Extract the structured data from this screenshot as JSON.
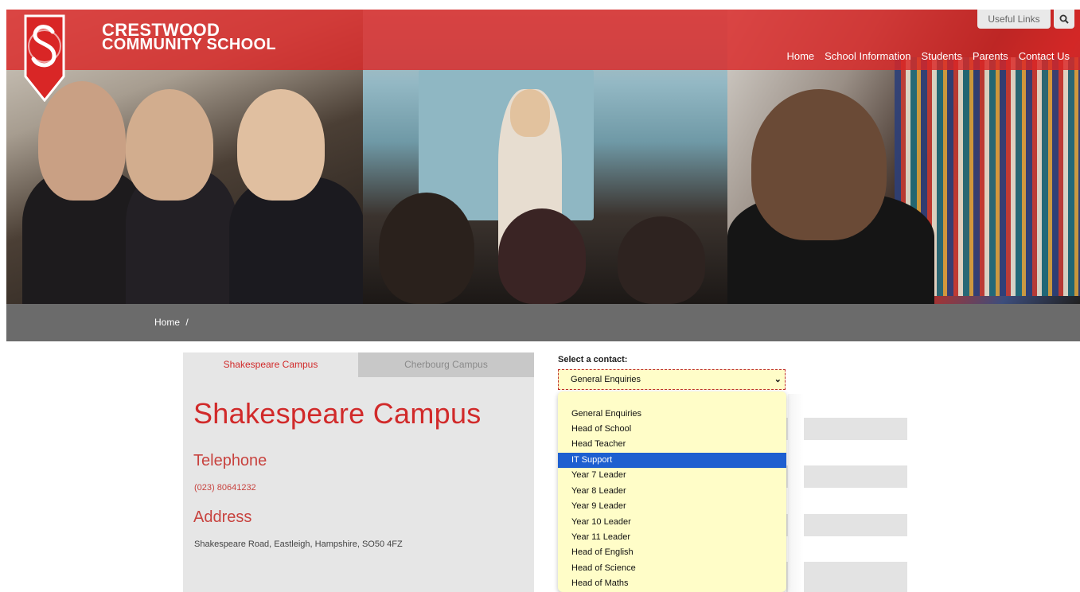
{
  "header": {
    "school_line1": "CRESTWOOD",
    "school_line2": "COMMUNITY SCHOOL",
    "useful_links": "Useful Links",
    "search_icon": "search-icon",
    "nav": [
      "Home",
      "School Information",
      "Students",
      "Parents",
      "Contact Us"
    ],
    "brand_color": "#d92626"
  },
  "breadcrumb": {
    "home": "Home",
    "separator": "/"
  },
  "campus_tabs": [
    "Shakespeare Campus",
    "Cherbourg Campus"
  ],
  "campus": {
    "title": "Shakespeare Campus",
    "telephone_heading": "Telephone",
    "telephone": "(023) 80641232",
    "address_heading": "Address",
    "address": "Shakespeare Road, Eastleigh, Hampshire, SO50 4FZ"
  },
  "contact_form": {
    "label": "Select a contact:",
    "selected": "General Enquiries",
    "highlighted": "IT Support",
    "options": [
      "General Enquiries",
      "Head of School",
      "Head Teacher",
      "IT Support",
      "Year 7 Leader",
      "Year 8 Leader",
      "Year 9 Leader",
      "Year 10 Leader",
      "Year 11 Leader",
      "Head of English",
      "Head of Science",
      "Head of Maths"
    ]
  }
}
